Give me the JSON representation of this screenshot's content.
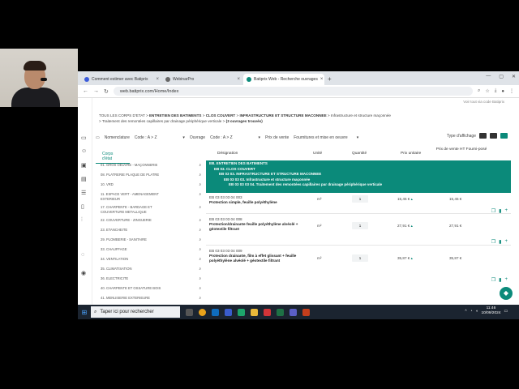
{
  "browser": {
    "tabs": [
      {
        "label": "Comment estimer avec Batiprix",
        "color": "#3b5bdb"
      },
      {
        "label": "WebinarPro",
        "color": "#e03131"
      },
      {
        "label": "Batiprix Web - Recherche ouvrages",
        "color": "#0b8a7a"
      }
    ],
    "url": "web.batiprix.com/Home/Index"
  },
  "app": {
    "breadcrumb": {
      "l1": "TOUS LES CORPS D'ETAT",
      "l2": "ENTRETIEN DES BATIMENTS",
      "l3": "CLOS COUVERT",
      "l4": "INFRASTRUCTURE ET STRUCTURE MACONNEE",
      "l5": "Infrastructure et structure maçonnée",
      "l6": "Traitement des remontées capillaires par drainage périphérique verticale",
      "l7": "(3 ouvrages trouvés)"
    },
    "top_hint": "Voir tout via code Batiprix",
    "filters": {
      "nomenclature_label": "Nomenclature",
      "nomenclature_value": "Code : A > Z",
      "ouvrage_label": "Ouvrage",
      "ouvrage_value": "Code : A > Z",
      "prix_label": "Prix de vente",
      "prix_value": "Fournitures et mise en oeuvre",
      "type_label": "Type d'affichage"
    },
    "left_title": "Corps d'état",
    "corps": [
      "01. GROS OEUVRE - MAÇONNERIE",
      "08. PLATRERIE PLAQUE DE PLATRE",
      "10. VRD",
      "11. ESPACE VERT - AMENAGEMENT EXTERIEUR",
      "17. CHARPENTE - BARDAGE ET COUVERTURE METALLIQUE",
      "22. COUVERTURE - ZINGUERIE",
      "23. ETANCHEITE",
      "29. PLOMBERIE - SANITAIRE",
      "33. CHAUFFAGE",
      "34. VENTILATION",
      "35. CLIMATISATION",
      "36. ELECTRICITE",
      "40. CHARPENTE ET OSSATURE BOIS",
      "41. MENUISERIE EXTERIEURE"
    ],
    "table": {
      "headers": {
        "designation": "Désignation",
        "unite": "Unité",
        "quantite": "Quantité",
        "prix_unitaire": "Prix unitaire",
        "prix_vente": "Prix de vente HT Fourni-posé"
      },
      "band": [
        "EB. ENTRETIEN DES BATIMENTS",
        "EB 03. CLOS COUVERT",
        "EB 03 03. INFRASTRUCTURE ET STRUCTURE MACONNEE",
        "EB 03 03 03. Infrastructure et structure maçonnée",
        "EB 03 03 03 04. Traitement des remontées capillaires par drainage périphérique verticale"
      ],
      "rows": [
        {
          "code": "EB 03 03 03 04 003",
          "desc": "Protection simple, feuille polyéthylène",
          "unit": "m²",
          "qty": "1",
          "pu": "15,45 €",
          "pv": "15,45 €"
        },
        {
          "code": "EB 03 03 03 04 008",
          "desc": "Protection/drainante feuille polyéthylène alvéolé + géotextile filtrant",
          "unit": "m²",
          "qty": "1",
          "pu": "27,91 €",
          "pv": "27,91 €"
        },
        {
          "code": "EB 03 03 03 04 009",
          "desc": "Protection drainante, film à effet glissant + feuille polyéthylène alvéolé + géotextile filtrant",
          "unit": "m²",
          "qty": "1",
          "pu": "35,87 €",
          "pv": "35,87 €"
        }
      ]
    }
  },
  "taskbar": {
    "search_placeholder": "Taper ici pour rechercher",
    "time": "11:46",
    "date": "10/09/2024"
  }
}
